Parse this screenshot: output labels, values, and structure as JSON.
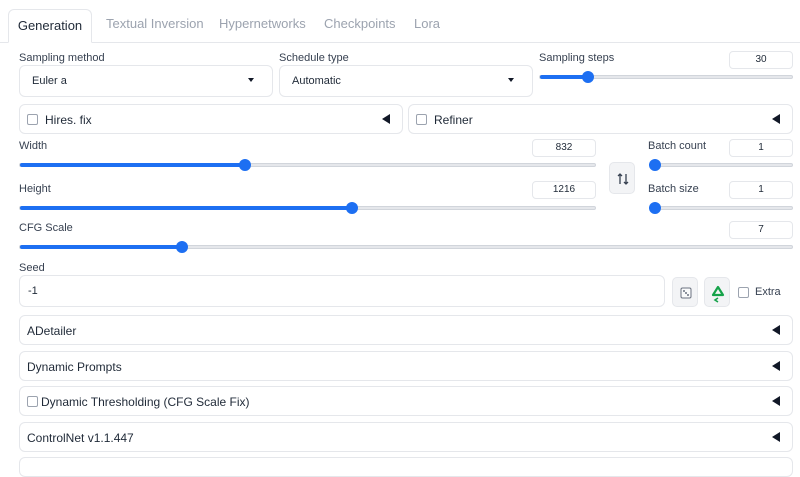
{
  "tabs": [
    "Generation",
    "Textual Inversion",
    "Hypernetworks",
    "Checkpoints",
    "Lora"
  ],
  "sampling_method": {
    "label": "Sampling method",
    "value": "Euler a"
  },
  "schedule_type": {
    "label": "Schedule type",
    "value": "Automatic"
  },
  "sampling_steps": {
    "label": "Sampling steps",
    "value": "30",
    "fraction": 0.19
  },
  "hires_fix": {
    "label": "Hires. fix"
  },
  "refiner": {
    "label": "Refiner"
  },
  "width": {
    "label": "Width",
    "value": "832",
    "fraction": 0.392
  },
  "height": {
    "label": "Height",
    "value": "1216",
    "fraction": 0.577
  },
  "batch_count": {
    "label": "Batch count",
    "value": "1",
    "fraction": 0.0
  },
  "batch_size": {
    "label": "Batch size",
    "value": "1",
    "fraction": 0.0
  },
  "cfg_scale": {
    "label": "CFG Scale",
    "value": "7",
    "fraction": 0.21
  },
  "seed": {
    "label": "Seed",
    "value": "-1",
    "extra_label": "Extra"
  },
  "panels": [
    "ADetailer",
    "Dynamic Prompts",
    "Dynamic Thresholding (CFG Scale Fix)",
    "ControlNet v1.1.447"
  ],
  "icons": {
    "swap": "swap-dimensions-icon",
    "dice": "dice-icon",
    "recycle": "recycle-icon"
  },
  "colors": {
    "accent": "#1d6ff2",
    "recycle": "#16a34a"
  }
}
